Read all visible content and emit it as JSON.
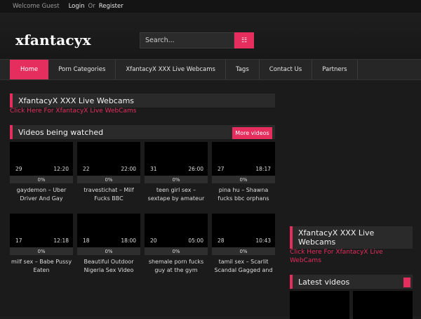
{
  "topbar": {
    "welcome": "Welcome Guest",
    "login": "Login",
    "or": "Or",
    "register": "Register"
  },
  "header": {
    "logo": "xfantacyx",
    "search_placeholder": "Search...",
    "search_icon": "grid-icon"
  },
  "nav": [
    {
      "label": "Home",
      "active": true
    },
    {
      "label": "Porn Categories"
    },
    {
      "label": "XfantacyX XXX Live Webcams"
    },
    {
      "label": "Tags"
    },
    {
      "label": "Contact Us"
    },
    {
      "label": "Partners"
    }
  ],
  "main": {
    "webcams_title": "XfantacyX XXX Live Webcams",
    "webcams_link": "Click Here For XfantacyX Live WebCams",
    "watched_title": "Videos being watched",
    "more_videos": "More videos",
    "videos": [
      {
        "num": "29",
        "time": "12:20",
        "pct": "0%",
        "cap1": "gaydemon – Uber",
        "cap2": "Driver And Gay"
      },
      {
        "num": "22",
        "time": "22:00",
        "pct": "0%",
        "cap1": "travestichat – Milf",
        "cap2": "Fucks BBC"
      },
      {
        "num": "31",
        "time": "26:00",
        "pct": "0%",
        "cap1": "teen girl sex –",
        "cap2": "sextape by amateur"
      },
      {
        "num": "27",
        "time": "18:17",
        "pct": "0%",
        "cap1": "pina hu – Shawna",
        "cap2": "fucks bbc orphans"
      },
      {
        "num": "17",
        "time": "12:18",
        "pct": "0%",
        "cap1": "milf sex – Babe Pussy",
        "cap2": "Eaten"
      },
      {
        "num": "18",
        "time": "18:00",
        "pct": "0%",
        "cap1": "Beautiful Outdoor",
        "cap2": "Nigeria Sex Video"
      },
      {
        "num": "20",
        "time": "05:00",
        "pct": "0%",
        "cap1": "shemale porn fucks",
        "cap2": "guy at the gym"
      },
      {
        "num": "28",
        "time": "10:43",
        "pct": "0%",
        "cap1": "tamil sex – Scarlit",
        "cap2": "Scandal Gagged and"
      }
    ]
  },
  "sidebar": {
    "webcams_title_1": "XfantacyX XXX Live",
    "webcams_title_2": "Webcams",
    "link_1": "Click Here For XfantacyX Live",
    "link_2": "WebCams",
    "latest_title": "Latest videos"
  },
  "colors": {
    "accent": "#e52d5e",
    "bg": "#1b1b1b"
  }
}
